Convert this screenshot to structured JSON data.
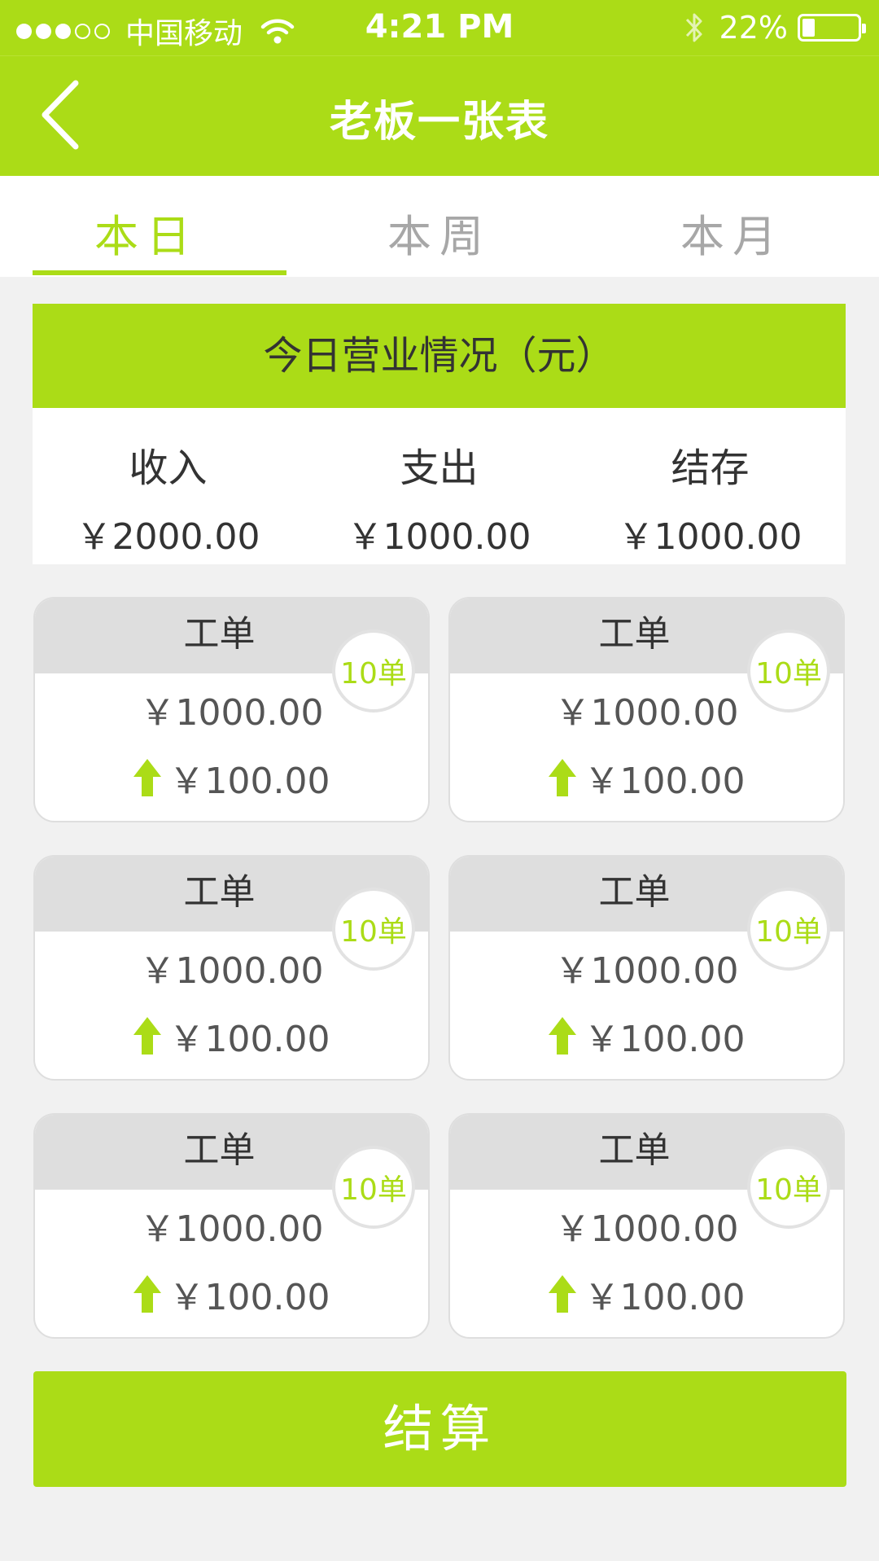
{
  "status_bar": {
    "carrier": "中国移动",
    "time": "4:21 PM",
    "battery": "22%",
    "battery_level": 0.22,
    "signal_bars": 3,
    "signal_total": 5
  },
  "nav": {
    "title": "老板一张表",
    "back_icon": "chevron-left-icon"
  },
  "tabs": [
    {
      "label": "本日",
      "active": true
    },
    {
      "label": "本周",
      "active": false
    },
    {
      "label": "本月",
      "active": false
    }
  ],
  "summary": {
    "title": "今日营业情况（元）",
    "cols": [
      {
        "label": "收入",
        "value": "￥2000.00"
      },
      {
        "label": "支出",
        "value": "￥1000.00"
      },
      {
        "label": "结存",
        "value": "￥1000.00"
      }
    ]
  },
  "cards": [
    {
      "title": "工单",
      "badge": "10单",
      "amount": "￥1000.00",
      "change": "￥100.00"
    },
    {
      "title": "工单",
      "badge": "10单",
      "amount": "￥1000.00",
      "change": "￥100.00"
    },
    {
      "title": "工单",
      "badge": "10单",
      "amount": "￥1000.00",
      "change": "￥100.00"
    },
    {
      "title": "工单",
      "badge": "10单",
      "amount": "￥1000.00",
      "change": "￥100.00"
    },
    {
      "title": "工单",
      "badge": "10单",
      "amount": "￥1000.00",
      "change": "￥100.00"
    },
    {
      "title": "工单",
      "badge": "10单",
      "amount": "￥1000.00",
      "change": "￥100.00"
    }
  ],
  "settle_label": "结算",
  "colors": {
    "accent": "#abdc17",
    "card_header": "#dedede",
    "background": "#f1f1f1",
    "text": "#333333"
  }
}
